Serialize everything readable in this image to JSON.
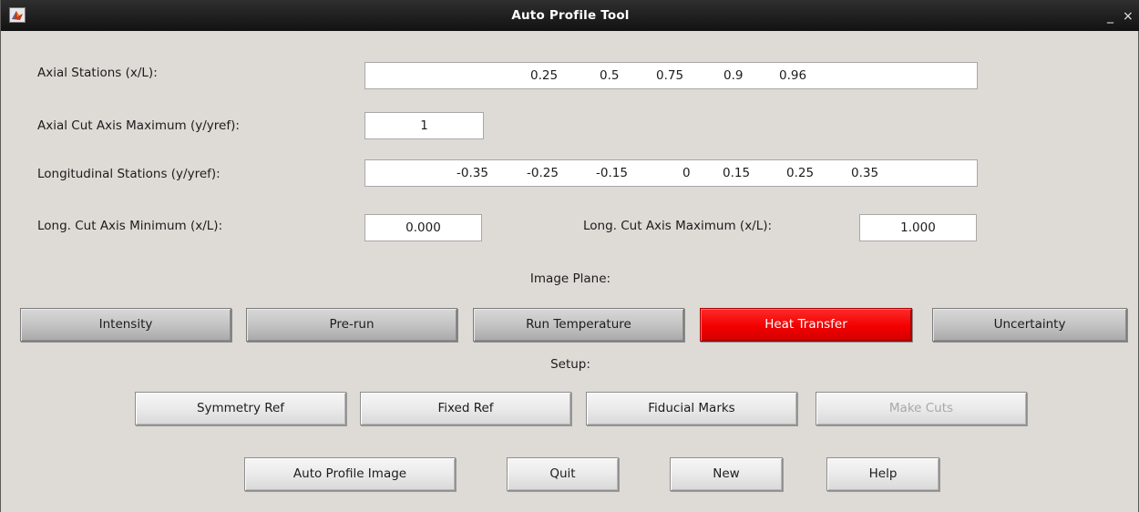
{
  "window": {
    "title": "Auto Profile Tool",
    "minimize_glyph": "_",
    "close_glyph": "×",
    "icon": "matlab-logo-icon"
  },
  "fields": {
    "axial_stations": {
      "label": "Axial Stations (x/L):",
      "values": [
        "0.25",
        "0.5",
        "0.75",
        "0.9",
        "0.96"
      ]
    },
    "axial_cut_max": {
      "label": "Axial Cut Axis Maximum (y/yref):",
      "value": "1"
    },
    "longitudinal_stations": {
      "label": "Longitudinal Stations (y/yref):",
      "values": [
        "-0.35",
        "-0.25",
        "-0.15",
        "0",
        "0.15",
        "0.25",
        "0.35"
      ]
    },
    "long_cut_min": {
      "label": "Long. Cut Axis Minimum (x/L):",
      "value": "0.000"
    },
    "long_cut_max": {
      "label": "Long. Cut Axis Maximum (x/L):",
      "value": "1.000"
    }
  },
  "image_plane": {
    "label": "Image Plane:",
    "buttons": [
      "Intensity",
      "Pre-run",
      "Run Temperature",
      "Heat Transfer",
      "Uncertainty"
    ],
    "selected": "Heat Transfer",
    "selected_color": "#f20000"
  },
  "setup": {
    "label": "Setup:",
    "buttons": [
      "Symmetry Ref",
      "Fixed Ref",
      "Fiducial Marks",
      "Make Cuts"
    ],
    "disabled": "Make Cuts"
  },
  "actions": {
    "buttons": [
      "Auto Profile Image",
      "Quit",
      "New",
      "Help"
    ]
  }
}
